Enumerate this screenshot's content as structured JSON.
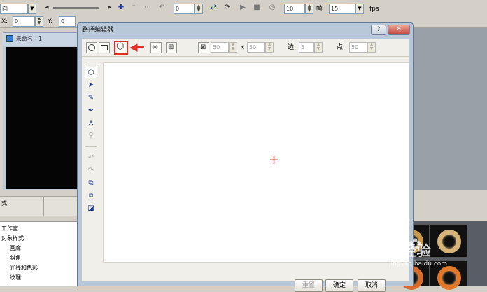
{
  "app_toolbar": {
    "field_direction": "向",
    "field_frame": "0",
    "field_count": "10",
    "label_axis": "帧",
    "field_fps": "15",
    "label_fps": "fps",
    "label_x": "X:",
    "field_x": "0",
    "label_y": "Y:",
    "field_y": "0"
  },
  "doc_window": {
    "title": "未命名 - 1"
  },
  "status_strip": {
    "label": "式:"
  },
  "tree": {
    "items": [
      "工作室",
      "对象样式",
      "画廊",
      "斜角",
      "光线和色彩",
      "纹理"
    ]
  },
  "dialog": {
    "title": "路径编辑器",
    "help_label": "?",
    "close_label": "✕",
    "width_value": "50",
    "times_sign": "×",
    "height_value": "50",
    "sides_label": "边:",
    "sides_value": "5",
    "points_label": "点:",
    "points_value": "50",
    "reset_button": "重置",
    "ok_button": "确定",
    "cancel_button": "取消"
  },
  "watermark": {
    "text": "Bai经验",
    "url": "jingyan.baidu.com"
  },
  "colors": {
    "highlight_red": "#e0302a",
    "dialog_frame": "#b8c8d9",
    "crosshair": "#d04040"
  }
}
